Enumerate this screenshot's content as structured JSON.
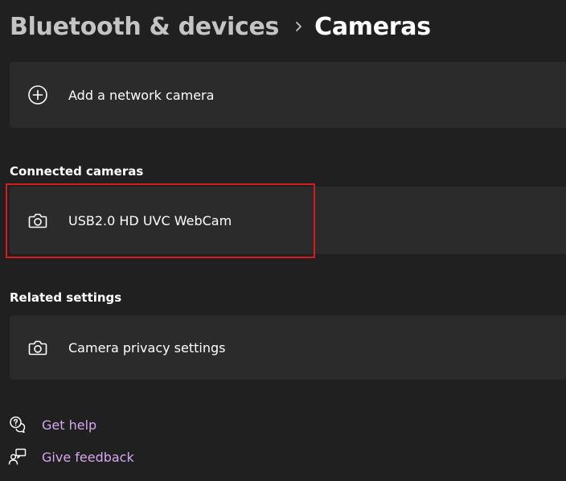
{
  "breadcrumb": {
    "parent": "Bluetooth & devices",
    "current": "Cameras",
    "separator_icon": "chevron-right-icon"
  },
  "add_camera": {
    "label": "Add a network camera",
    "icon": "add-circle-icon"
  },
  "connected_cameras": {
    "title": "Connected cameras",
    "items": [
      {
        "label": "USB2.0 HD UVC WebCam",
        "icon": "camera-icon"
      }
    ]
  },
  "related_settings": {
    "title": "Related settings",
    "items": [
      {
        "label": "Camera privacy settings",
        "icon": "camera-icon"
      }
    ]
  },
  "footer_links": {
    "get_help": "Get help",
    "give_feedback": "Give feedback"
  },
  "colors": {
    "background": "#202020",
    "card": "#2b2b2b",
    "link": "#d7a8f0",
    "highlight": "#d81b1b"
  }
}
